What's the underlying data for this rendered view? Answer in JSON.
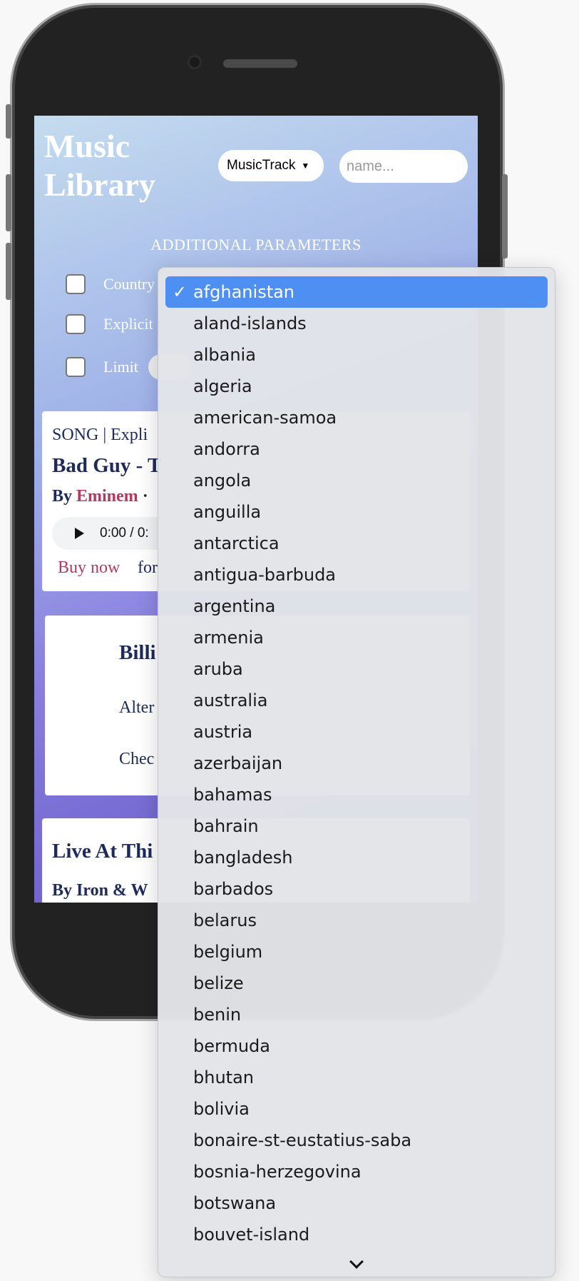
{
  "app": {
    "title": "Music Library",
    "type_select": "MusicTrack",
    "name_placeholder": "name...",
    "params_heading": "ADDITIONAL PARAMETERS",
    "params": [
      "Country",
      "Explicit",
      "Limit"
    ]
  },
  "cards": {
    "track": {
      "meta": "SONG | Expli",
      "title": "Bad Guy - T",
      "by_label": "By",
      "artist": "Eminem",
      "dot": "·",
      "time": "0:00 / 0:",
      "buy": "Buy now",
      "for": "for"
    },
    "artist": {
      "name": "Billi",
      "genre": "Alter",
      "check": "Chec"
    },
    "album": {
      "title": "Live At Thi",
      "by": "By Iron & W"
    }
  },
  "dropdown": {
    "selected_mark": "✓",
    "options": [
      "afghanistan",
      "aland-islands",
      "albania",
      "algeria",
      "american-samoa",
      "andorra",
      "angola",
      "anguilla",
      "antarctica",
      "antigua-barbuda",
      "argentina",
      "armenia",
      "aruba",
      "australia",
      "austria",
      "azerbaijan",
      "bahamas",
      "bahrain",
      "bangladesh",
      "barbados",
      "belarus",
      "belgium",
      "belize",
      "benin",
      "bermuda",
      "bhutan",
      "bolivia",
      "bonaire-st-eustatius-saba",
      "bosnia-herzegovina",
      "botswana",
      "bouvet-island"
    ],
    "selected_index": 0
  }
}
